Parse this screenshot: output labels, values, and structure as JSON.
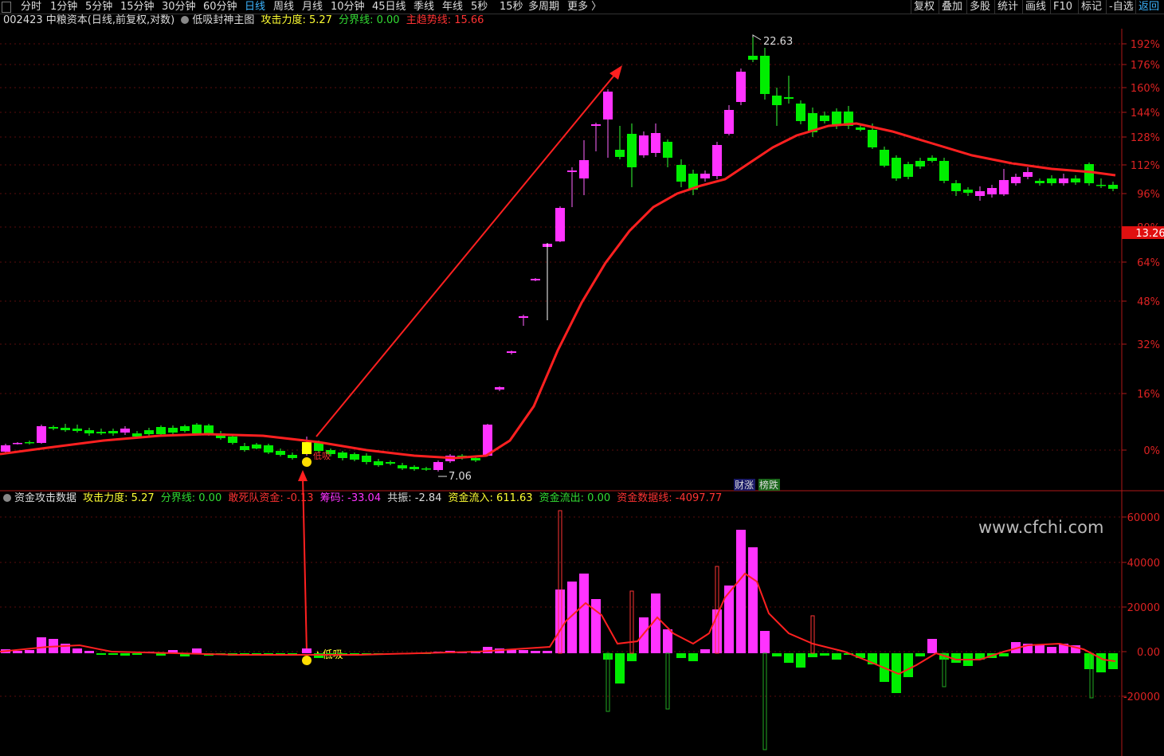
{
  "toolbar": {
    "periods": [
      "分时",
      "1分钟",
      "5分钟",
      "15分钟",
      "30分钟",
      "60分钟",
      "日线",
      "周线",
      "月线",
      "10分钟",
      "45日线",
      "季线",
      "年线",
      "5秒",
      "15秒",
      "多周期",
      "更多 〉"
    ],
    "active_period": "日线",
    "right_buttons": [
      "复权",
      "叠加",
      "多股",
      "统计",
      "画线",
      "F10",
      "标记",
      "-自选",
      "返回"
    ]
  },
  "main_legend": {
    "stock": "002423 中粮资本(日线,前复权,对数)",
    "indicator": "低吸封神主图",
    "attack_label": "攻击力度: 5.27",
    "split_label": "分界线: 0.00",
    "trend_label": "主趋势线: 15.66"
  },
  "sub_legend": {
    "name": "资金攻击数据",
    "attack": "攻击力度: 5.27",
    "split": "分界线: 0.00",
    "dare": "敢死队资金: -0.13",
    "chip": "筹码: -33.04",
    "resonance": "共振: -2.84",
    "inflow": "资金流入: 611.63",
    "outflow": "资金流出: 0.00",
    "dataline": "资金数据线: -4097.77"
  },
  "price_axis": [
    "192%",
    "176%",
    "160%",
    "144%",
    "128%",
    "112%",
    "96%",
    "80%",
    "64%",
    "48%",
    "32%",
    "16%",
    "0%"
  ],
  "current_price": "13.26",
  "sub_axis": [
    "60000",
    "40000",
    "20000",
    "0.00",
    "-20000"
  ],
  "annotations": {
    "high": "22.63",
    "low": "7.06",
    "buy_signal": "低吸",
    "buy_signal_sub": "★低吸",
    "badge1": "财涨",
    "badge2": "榜跌",
    "watermark": "www.cfchi.com"
  },
  "colors": {
    "up": "#ff33ff",
    "down": "#00ee00",
    "trend": "#ff2020",
    "axis": "#cc2020",
    "signal": "#ffff00"
  }
}
